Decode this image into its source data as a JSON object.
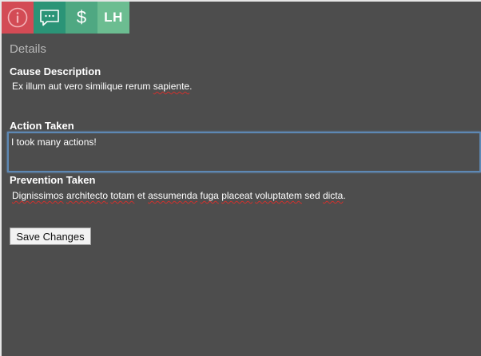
{
  "tabs": {
    "info": {
      "icon": "info-icon",
      "color": "#d34b55"
    },
    "comments": {
      "icon": "speech-bubble-icon",
      "color": "#2b9477"
    },
    "cost": {
      "icon": "dollar-icon",
      "label": "$",
      "color": "#4fa882"
    },
    "initials": {
      "label": "LH",
      "color": "#6cbd91"
    }
  },
  "details": {
    "title": "Details",
    "cause": {
      "label": "Cause Description",
      "value_pre": "Ex illum aut vero similique rerum ",
      "value_err": "sapiente",
      "value_post": "."
    },
    "action": {
      "label": "Action Taken",
      "value": "I took many actions!"
    },
    "prevention": {
      "label": "Prevention Taken",
      "value_parts": [
        {
          "text": "Dignissimos",
          "misspelled": true
        },
        {
          "text": " ",
          "misspelled": false
        },
        {
          "text": "architecto",
          "misspelled": true
        },
        {
          "text": " ",
          "misspelled": false
        },
        {
          "text": "totam",
          "misspelled": true
        },
        {
          "text": " et ",
          "misspelled": false
        },
        {
          "text": "assumenda",
          "misspelled": true
        },
        {
          "text": " ",
          "misspelled": false
        },
        {
          "text": "fuga",
          "misspelled": true
        },
        {
          "text": " ",
          "misspelled": false
        },
        {
          "text": "placeat",
          "misspelled": true
        },
        {
          "text": " ",
          "misspelled": false
        },
        {
          "text": "voluptatem",
          "misspelled": true
        },
        {
          "text": " sed ",
          "misspelled": false
        },
        {
          "text": "dicta",
          "misspelled": true
        },
        {
          "text": ".",
          "misspelled": false
        }
      ]
    },
    "save_label": "Save Changes"
  },
  "colors": {
    "panel_bg": "#4d4d4d",
    "focus_border": "#5d88b4",
    "spellcheck": "#d0312d"
  }
}
